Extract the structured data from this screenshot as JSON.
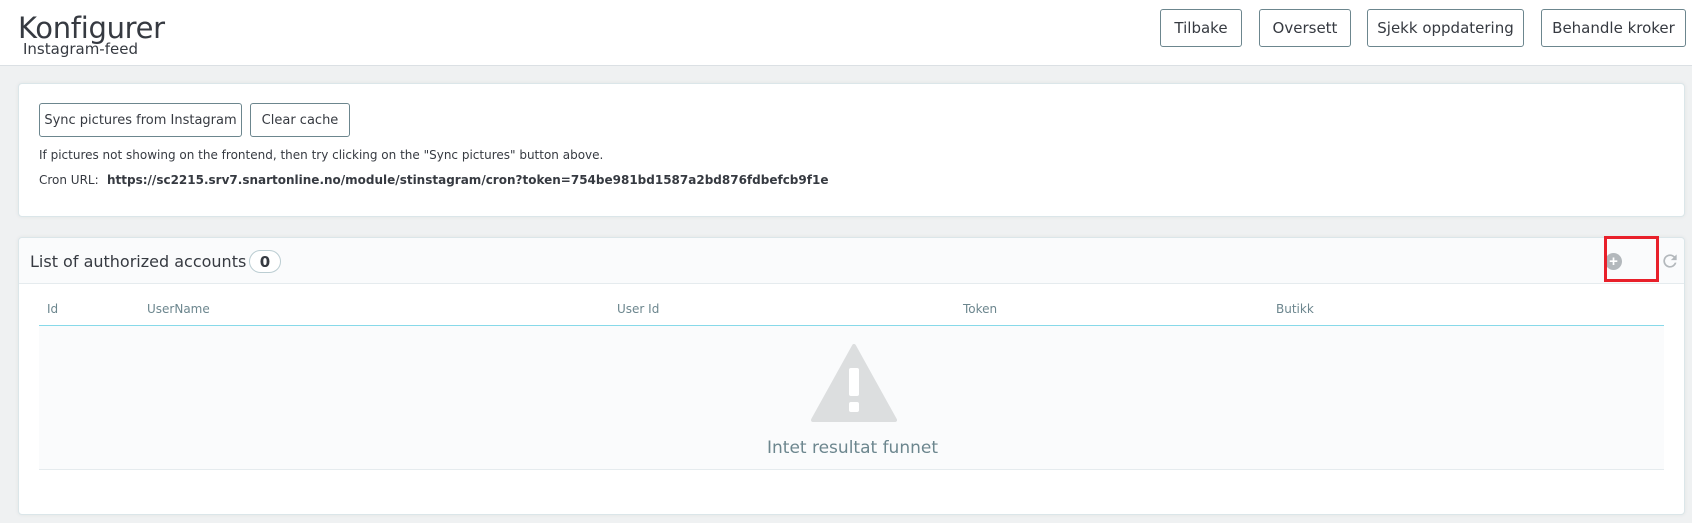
{
  "header": {
    "title": "Konfigurer",
    "subtitle": "Instagram-feed",
    "buttons": {
      "back": "Tilbake",
      "translate": "Oversett",
      "check_update": "Sjekk oppdatering",
      "manage_hooks": "Behandle kroker"
    }
  },
  "sync_panel": {
    "sync_button": "Sync pictures from Instagram",
    "clear_cache_button": "Clear cache",
    "help_text": "If pictures not showing on the frontend, then try clicking on the \"Sync pictures\" button above.",
    "cron_label": "Cron URL:",
    "cron_url": "https://sc2215.srv7.snartonline.no/module/stinstagram/cron?token=754be981bd1587a2bd876fdbefcb9f1e"
  },
  "accounts_panel": {
    "title": "List of authorized accounts",
    "count": "0",
    "columns": [
      "Id",
      "UserName",
      "User Id",
      "Token",
      "Butikk"
    ],
    "empty_message": "Intet resultat funnet",
    "icons": {
      "add": "add-circle-icon",
      "refresh": "refresh-icon",
      "empty": "warning-icon"
    }
  },
  "colors": {
    "accent": "#25b9d7",
    "border": "#6c868e",
    "highlight": "#e8202a",
    "muted_icon": "#b3b8bc"
  }
}
